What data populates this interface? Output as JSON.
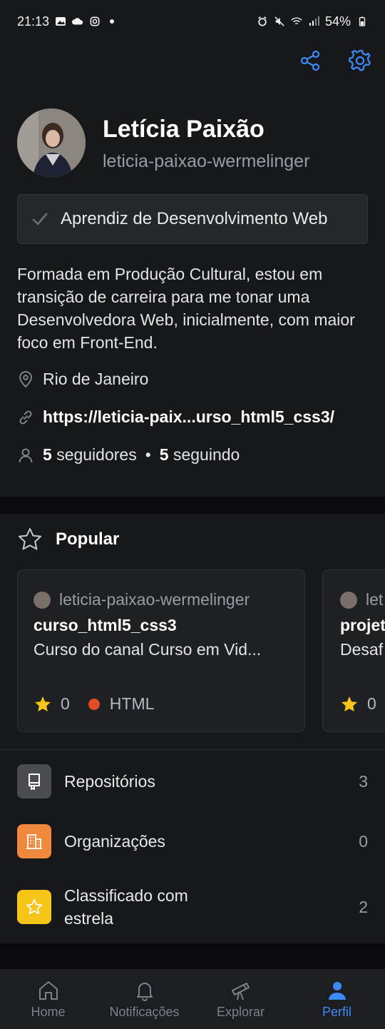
{
  "statusbar": {
    "time": "21:13",
    "battery": "54%",
    "left_icons": [
      "gallery-icon",
      "cloud-icon",
      "instagram-icon",
      "dot-icon"
    ],
    "right_icons": [
      "alarm-icon",
      "mute-icon",
      "wifi-icon",
      "signal-icon",
      "battery-icon"
    ]
  },
  "header": {
    "share_icon": "share-icon",
    "settings_icon": "gear-icon"
  },
  "profile": {
    "name": "Letícia Paixão",
    "login": "leticia-paixao-wermelinger",
    "status": "Aprendiz de Desenvolvimento Web",
    "bio": "Formada em Produção Cultural, estou em transição de carreira para me tonar uma Desenvolvedora Web, inicialmente, com maior foco em Front-End.",
    "location": "Rio de Janeiro",
    "website": "https://leticia-paix...urso_html5_css3/",
    "followers_count": "5",
    "followers_label": "seguidores",
    "following_count": "5",
    "following_label": "seguindo"
  },
  "popular": {
    "title": "Popular",
    "cards": [
      {
        "owner": "leticia-paixao-wermelinger",
        "repo": "curso_html5_css3",
        "description": "Curso do canal Curso em Vid...",
        "stars": "0",
        "language": "HTML"
      },
      {
        "owner": "let",
        "repo": "projet",
        "description": "Desaf",
        "stars": "0"
      }
    ]
  },
  "menu": {
    "items": [
      {
        "label": "Repositórios",
        "count": "3",
        "icon": "repo-icon",
        "color": "#4a4c52"
      },
      {
        "label": "Organizações",
        "count": "0",
        "icon": "organization-icon",
        "color": "#f0883e"
      },
      {
        "label": "Classificado com estrela",
        "count": "2",
        "icon": "star-icon",
        "color": "#f5c518"
      }
    ]
  },
  "tabbar": {
    "tabs": [
      {
        "label": "Home",
        "icon": "home-icon"
      },
      {
        "label": "Notificações",
        "icon": "bell-icon"
      },
      {
        "label": "Explorar",
        "icon": "telescope-icon"
      },
      {
        "label": "Perfil",
        "icon": "person-icon",
        "active": true
      }
    ]
  },
  "colors": {
    "accent": "#3d8af7",
    "background": "#17181b",
    "html_language": "#e34c26",
    "star": "#f5c518"
  }
}
